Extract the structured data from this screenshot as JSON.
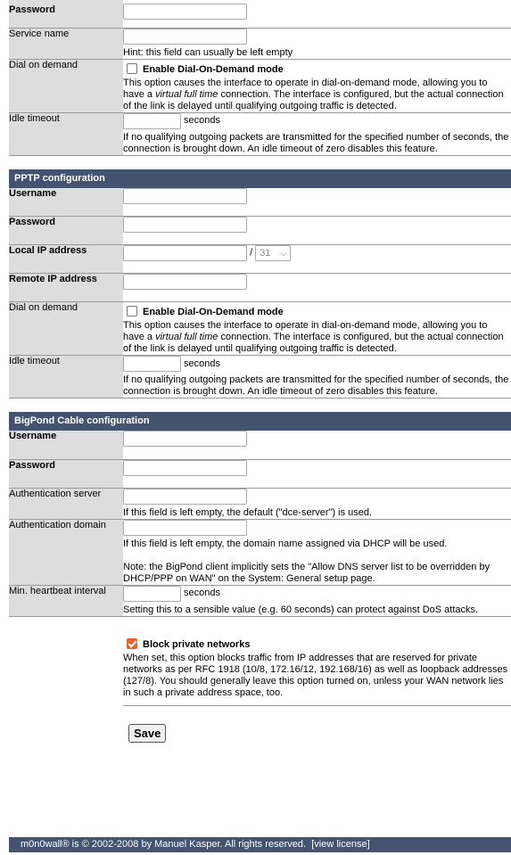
{
  "top": {
    "password_label": "Password",
    "service_name_label": "Service name",
    "service_name_hint": "Hint: this field can usually be left empty",
    "dial_label": "Dial on demand",
    "dial_checkbox": "Enable Dial-On-Demand mode",
    "dial_desc_a": "This option causes the interface to operate in dial-on-demand mode, allowing you to have a ",
    "dial_desc_em": "virtual full time",
    "dial_desc_b": " connection. The interface is configured, but the actual connection of the link is delayed until qualifying outgoing traffic is detected.",
    "idle_label": "Idle timeout",
    "idle_units": "seconds",
    "idle_desc": "If no qualifying outgoing packets are transmitted for the specified number of seconds, the connection is brought down. An idle timeout of zero disables this feature."
  },
  "pptp": {
    "title": "PPTP configuration",
    "username_label": "Username",
    "password_label": "Password",
    "local_ip_label": "Local IP address",
    "subnet_sep": "/",
    "subnet_value": "31",
    "remote_ip_label": "Remote IP address",
    "dial_label": "Dial on demand",
    "dial_checkbox": "Enable Dial-On-Demand mode",
    "dial_desc_a": "This option causes the interface to operate in dial-on-demand mode, allowing you to have a ",
    "dial_desc_em": "virtual full time",
    "dial_desc_b": " connection. The interface is configured, but the actual connection of the link is delayed until qualifying outgoing traffic is detected.",
    "idle_label": "Idle timeout",
    "idle_units": "seconds",
    "idle_desc": "If no qualifying outgoing packets are transmitted for the specified number of seconds, the connection is brought down. An idle timeout of zero disables this feature."
  },
  "bigpond": {
    "title": "BigPond Cable configuration",
    "username_label": "Username",
    "password_label": "Password",
    "auth_server_label": "Authentication server",
    "auth_server_hint": "If this field is left empty, the default (\"dce-server\") is used.",
    "auth_domain_label": "Authentication domain",
    "auth_domain_hint": "If this field is left empty, the domain name assigned via DHCP will be used.",
    "auth_domain_note": "Note: the BigPond client implicitly sets the \"Allow DNS server list to be overridden by DHCP/PPP on WAN\" on the System: General setup page.",
    "heartbeat_label": "Min. heartbeat interval",
    "heartbeat_units": "seconds",
    "heartbeat_hint": "Setting this to a sensible value (e.g. 60 seconds) can protect against DoS attacks."
  },
  "private": {
    "checkbox_label": "Block private networks",
    "checked": true,
    "desc": "When set, this option blocks traffic from IP addresses that are reserved for private networks as per RFC 1918 (10/8, 172.16/12, 192.168/16) as well as loopback addresses (127/8). You should generally leave this option turned on, unless your WAN network lies in such a private address space, too."
  },
  "save_label": "Save",
  "footer": {
    "text": "m0n0wall® is © 2002-2008 by Manuel Kasper. All rights reserved.",
    "link": "[view license]"
  },
  "colors": {
    "section_bg": "#435370",
    "label_bg": "#dddddd",
    "checkbox_on": "#e8622c"
  }
}
